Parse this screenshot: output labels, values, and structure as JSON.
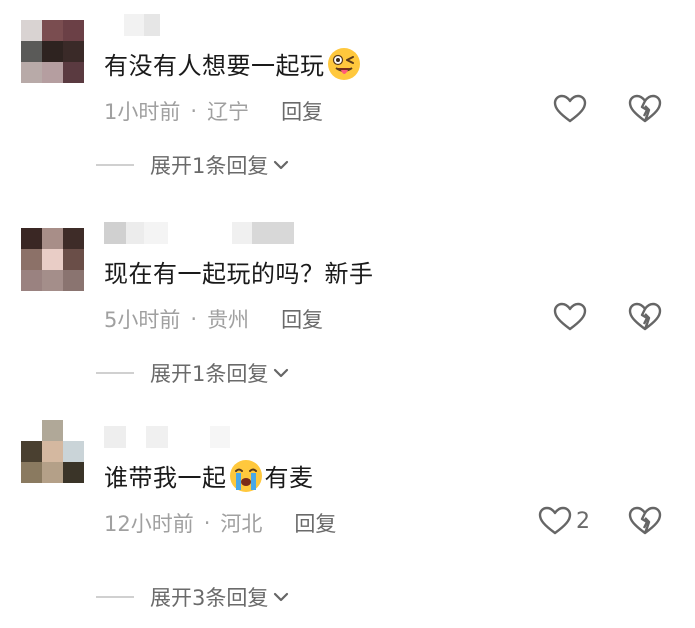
{
  "comments": [
    {
      "text_before": "有没有人想要一起玩",
      "emoji": "winking-tongue-emoji",
      "text_after": "",
      "time": "1小时前",
      "location": "辽宁",
      "reply_label": "回复",
      "like_count": "",
      "expand_label": "展开1条回复"
    },
    {
      "text_before": "现在有一起玩的吗？新手",
      "emoji": "",
      "text_after": "",
      "time": "5小时前",
      "location": "贵州",
      "reply_label": "回复",
      "like_count": "",
      "expand_label": "展开1条回复"
    },
    {
      "text_before": "谁带我一起",
      "emoji": "crying-face-emoji",
      "text_after": "有麦",
      "time": "12小时前",
      "location": "河北",
      "reply_label": "回复",
      "like_count": "2",
      "expand_label": "展开3条回复"
    }
  ],
  "separator": "·",
  "colors": {
    "text": "#1a1a1a",
    "meta": "#a0a0a0",
    "secondary": "#6a6a6a",
    "icon_stroke": "#666666"
  }
}
